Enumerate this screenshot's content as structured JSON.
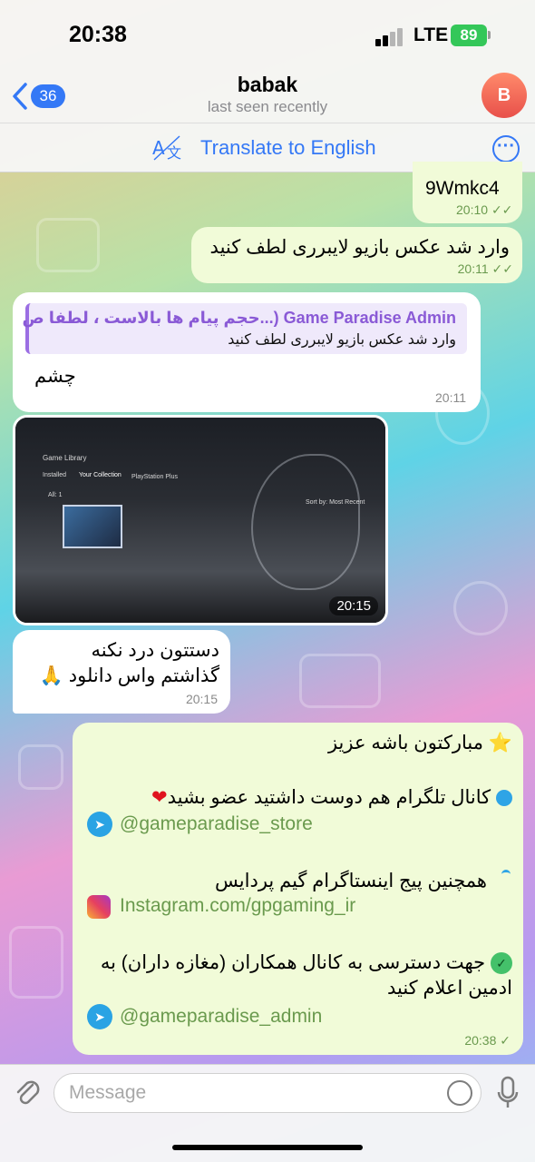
{
  "status": {
    "time": "20:38",
    "network": "LTE",
    "battery": "89"
  },
  "header": {
    "back_count": "36",
    "title": "babak",
    "subtitle": "last seen recently",
    "avatar_letter": "B"
  },
  "translate": {
    "label": "Translate to English"
  },
  "messages": {
    "m1": {
      "text": "9Wmkc4",
      "time": "20:10",
      "status": "✓✓"
    },
    "m2": {
      "text": "وارد شد عکس بازیو لایبرری لطف کنید",
      "time": "20:11",
      "status": "✓✓"
    },
    "m3": {
      "reply_name": "Game Paradise Admin (...حجم پیام ها بالاست ، لطفا ص",
      "reply_text": "وارد شد عکس بازیو لایبرری لطف کنید",
      "text": "چشم",
      "time": "20:11"
    },
    "m4": {
      "time": "20:15",
      "screen_title": "Game Library",
      "tabs": [
        "Installed",
        "Your Collection",
        "PlayStation Plus"
      ],
      "sort": "Sort by: Most Recent",
      "count": "All: 1"
    },
    "m5": {
      "line1": "دستتون درد نکنه",
      "line2": "گذاشتم واس دانلود 🙏",
      "time": "20:15"
    },
    "m6": {
      "line1": "مبارکتون باشه عزیز",
      "line2": "کانال تلگرام هم دوست داشتید عضو بشید",
      "link1": "@gameparadise_store",
      "line3": "همچنین پیج اینستاگرام گیم پردایس",
      "link2": "Instagram.com/gpgaming_ir",
      "line4a": "جهت دسترسی به کانال همکاران (مغازه داران) به",
      "line4b": "ادمین اعلام کنید",
      "link3": "@gameparadise_admin",
      "time": "20:38",
      "status": "✓"
    }
  },
  "input": {
    "placeholder": "Message"
  },
  "colors": {
    "accent": "#3478f6",
    "outgoing_bubble": "#f1fbd8",
    "incoming_bubble": "#ffffff",
    "link": "#6a9a4e"
  },
  "icons": {
    "back": "chevron-left-icon",
    "translate": "translate-icon",
    "more": "more-icon",
    "attach": "paperclip-icon",
    "sticker": "sticker-icon",
    "mic": "microphone-icon"
  }
}
